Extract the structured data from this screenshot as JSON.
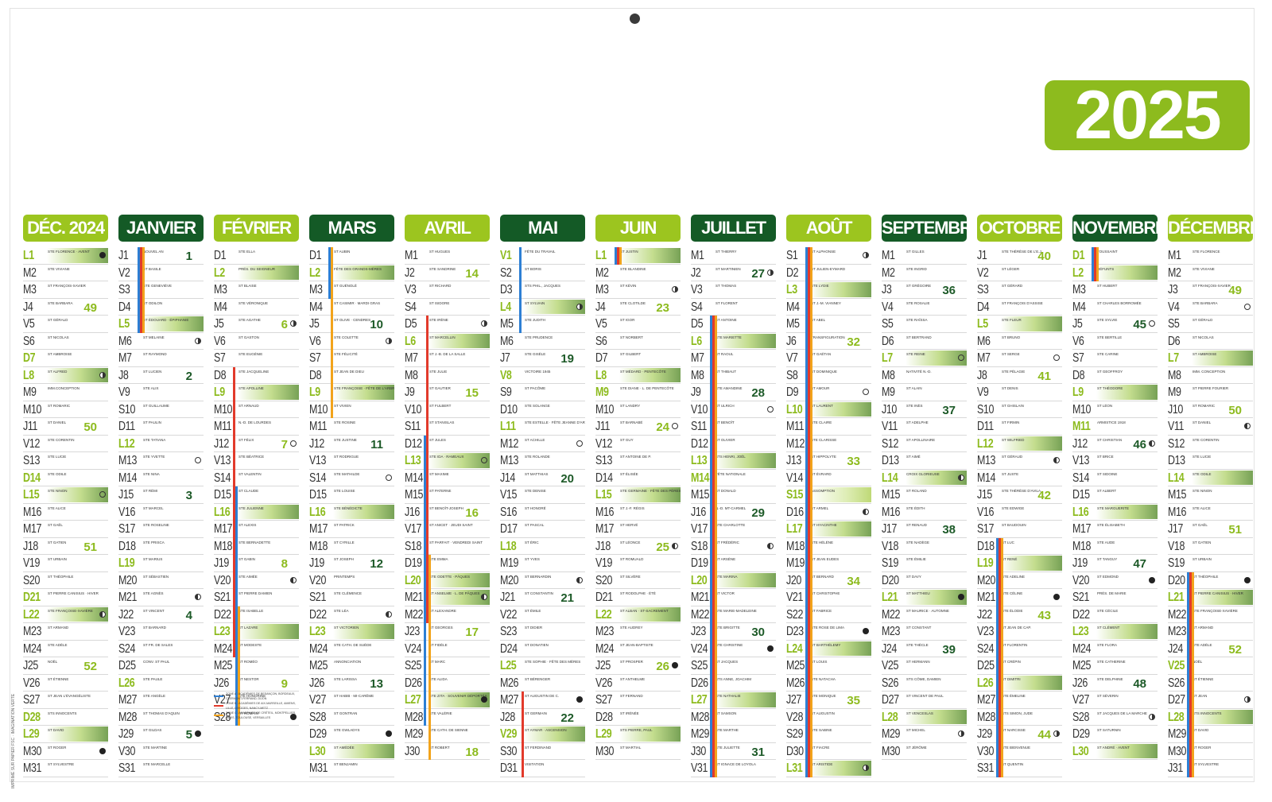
{
  "calendar": {
    "year": "2025",
    "side_text": "IMPRIMÉ SUR PAPIER FSC · IMAGINATION VERTE",
    "legend": [
      "ZONE A : ACADÉMIES DE BESANÇON, BORDEAUX, CLERMONT-FERRAND, DIJON",
      "ZONE B : ACADÉMIES DE AIX-MARSEILLE, AMIENS, LILLE, LIMOGES, NANCY-METZ",
      "ZONE C : ACADÉMIES DE CRÉTEIL, MONTPELLIER, PARIS, TOULOUSE, VERSAILLES"
    ],
    "legend_colors": [
      "#2d7fd4",
      "#e23a2b",
      "#f2a31b"
    ],
    "months": [
      {
        "name": "DÉC. 2024",
        "style": "light",
        "start": 0,
        "days": 31,
        "weekends": [
          1,
          7,
          8,
          14,
          15,
          21,
          22,
          28,
          29
        ],
        "weeks": {
          "4": "49",
          "11": "50",
          "18": "51",
          "25": "52"
        },
        "grad": [
          1,
          8,
          15,
          22,
          29
        ],
        "moons": {
          "1": "new",
          "8": "q1",
          "15": "full",
          "22": "q3",
          "30": "new"
        }
      },
      {
        "name": "JANVIER",
        "style": "dark",
        "start": 3,
        "days": 31,
        "weekends": [
          5,
          12,
          19,
          26
        ],
        "weeks": {
          "1": "1",
          "8": "2",
          "15": "3",
          "22": "4",
          "29": "5"
        },
        "grad": [
          5
        ],
        "moons": {
          "6": "q1",
          "13": "full",
          "21": "q3",
          "29": "new"
        },
        "vac": [
          [
            1,
            5,
            "#2d7fd4"
          ],
          [
            1,
            5,
            "#e23a2b"
          ],
          [
            1,
            5,
            "#f2a31b"
          ]
        ]
      },
      {
        "name": "FÉVRIER",
        "style": "light",
        "start": 6,
        "days": 28,
        "weekends": [
          2,
          9,
          16,
          23
        ],
        "weeks": {
          "5": "6",
          "12": "7",
          "19": "8",
          "26": "9"
        },
        "grad": [
          2,
          9,
          16,
          23
        ],
        "moons": {
          "5": "q1",
          "12": "full",
          "20": "q3",
          "28": "new"
        },
        "vac": [
          [
            8,
            24,
            "#e23a2b"
          ],
          [
            15,
            28,
            "#2d7fd4"
          ],
          [
            22,
            28,
            "#f2a31b"
          ]
        ]
      },
      {
        "name": "MARS",
        "style": "dark",
        "start": 6,
        "days": 31,
        "weekends": [
          2,
          9,
          16,
          23,
          30
        ],
        "weeks": {
          "5": "10",
          "12": "11",
          "19": "12",
          "26": "13"
        },
        "grad": [
          2,
          9,
          16,
          23,
          30
        ],
        "moons": {
          "6": "q1",
          "14": "full",
          "22": "q3",
          "29": "new"
        },
        "vac": [
          [
            1,
            3,
            "#2d7fd4"
          ],
          [
            1,
            10,
            "#f2a31b"
          ]
        ]
      },
      {
        "name": "AVRIL",
        "style": "light",
        "start": 2,
        "days": 30,
        "weekends": [
          6,
          13,
          20,
          27
        ],
        "weeks": {
          "2": "14",
          "9": "15",
          "16": "16",
          "23": "17",
          "30": "18"
        },
        "grad": [
          6,
          13,
          20,
          21,
          27
        ],
        "moons": {
          "5": "q1",
          "13": "full",
          "21": "q3",
          "27": "new"
        },
        "vac": [
          [
            12,
            28,
            "#2d7fd4"
          ],
          [
            5,
            22,
            "#e23a2b"
          ],
          [
            19,
            30,
            "#f2a31b"
          ]
        ]
      },
      {
        "name": "MAI",
        "style": "dark",
        "start": 4,
        "days": 31,
        "weekends": [
          1,
          4,
          8,
          11,
          18,
          25,
          29
        ],
        "weeks": {
          "7": "19",
          "14": "20",
          "21": "21",
          "28": "22"
        },
        "grad": [
          4,
          29
        ],
        "moons": {
          "4": "q1",
          "12": "full",
          "20": "q3",
          "27": "new"
        },
        "vac": [
          [
            1,
            5,
            "#2d7fd4"
          ],
          [
            27,
            31,
            "#e23a2b"
          ]
        ]
      },
      {
        "name": "JUIN",
        "style": "light",
        "start": 0,
        "days": 30,
        "weekends": [
          1,
          8,
          9,
          15,
          22,
          29
        ],
        "weeks": {
          "4": "23",
          "11": "24",
          "18": "25",
          "25": "26"
        },
        "grad": [
          1,
          8,
          15,
          22,
          29
        ],
        "moons": {
          "3": "q1",
          "11": "full",
          "18": "q3",
          "25": "new"
        },
        "vac": [
          [
            1,
            1,
            "#2d7fd4"
          ],
          [
            1,
            1,
            "#e23a2b"
          ],
          [
            1,
            1,
            "#f2a31b"
          ]
        ]
      },
      {
        "name": "JUILLET",
        "style": "dark",
        "start": 2,
        "days": 31,
        "weekends": [
          6,
          13,
          14,
          20,
          27
        ],
        "weeks": {
          "2": "27",
          "9": "28",
          "16": "29",
          "23": "30",
          "30": "31"
        },
        "grad": [
          6,
          13,
          20,
          27
        ],
        "moons": {
          "2": "q1",
          "10": "full",
          "18": "q3",
          "24": "new"
        },
        "vac": [
          [
            5,
            31,
            "#2d7fd4"
          ],
          [
            5,
            31,
            "#e23a2b"
          ],
          [
            5,
            31,
            "#f2a31b"
          ]
        ]
      },
      {
        "name": "AOÛT",
        "style": "light",
        "start": 5,
        "days": 31,
        "weekends": [
          3,
          10,
          15,
          17,
          24,
          31
        ],
        "weeks": {
          "6": "32",
          "13": "33",
          "20": "34",
          "27": "35"
        },
        "grad": [
          3,
          10,
          15,
          17,
          24,
          31
        ],
        "moons": {
          "1": "q1",
          "9": "full",
          "16": "q3",
          "23": "new",
          "31": "q1"
        },
        "vac": [
          [
            1,
            31,
            "#2d7fd4"
          ],
          [
            1,
            31,
            "#e23a2b"
          ],
          [
            1,
            31,
            "#f2a31b"
          ]
        ]
      },
      {
        "name": "SEPTEMBRE",
        "style": "dark",
        "start": 1,
        "days": 30,
        "weekends": [
          7,
          14,
          21,
          28
        ],
        "weeks": {
          "3": "36",
          "10": "37",
          "17": "38",
          "24": "39"
        },
        "grad": [
          7,
          14,
          21,
          28
        ],
        "moons": {
          "7": "full",
          "14": "q3",
          "21": "new",
          "29": "q1"
        }
      },
      {
        "name": "OCTOBRE",
        "style": "light",
        "start": 3,
        "days": 31,
        "weekends": [
          5,
          12,
          19,
          26
        ],
        "weeks": {
          "1": "40",
          "8": "41",
          "15": "42",
          "22": "43",
          "29": "44"
        },
        "grad": [
          5,
          12,
          19,
          26
        ],
        "moons": {
          "7": "full",
          "13": "q3",
          "21": "new",
          "29": "q1"
        },
        "vac": [
          [
            18,
            31,
            "#2d7fd4"
          ],
          [
            18,
            31,
            "#e23a2b"
          ],
          [
            18,
            31,
            "#f2a31b"
          ]
        ]
      },
      {
        "name": "NOVEMBRE",
        "style": "dark",
        "start": 6,
        "days": 30,
        "weekends": [
          1,
          2,
          9,
          11,
          16,
          23,
          30
        ],
        "weeks": {
          "5": "45",
          "12": "46",
          "19": "47",
          "26": "48"
        },
        "grad": [
          2,
          9,
          16,
          23,
          30
        ],
        "moons": {
          "5": "full",
          "12": "q3",
          "20": "new",
          "28": "q1"
        },
        "vac": [
          [
            1,
            2,
            "#2d7fd4"
          ],
          [
            1,
            2,
            "#e23a2b"
          ],
          [
            1,
            2,
            "#f2a31b"
          ]
        ]
      },
      {
        "name": "DÉCEMBRE",
        "style": "light",
        "start": 1,
        "days": 31,
        "weekends": [
          7,
          14,
          21,
          25,
          28
        ],
        "weeks": {
          "3": "49",
          "10": "50",
          "17": "51",
          "24": "52"
        },
        "grad": [
          7,
          14,
          21,
          28
        ],
        "moons": {
          "4": "full",
          "11": "q3",
          "20": "new",
          "27": "q1"
        },
        "vac": [
          [
            20,
            31,
            "#2d7fd4"
          ],
          [
            20,
            31,
            "#e23a2b"
          ],
          [
            20,
            31,
            "#f2a31b"
          ]
        ]
      }
    ],
    "letters": [
      "L",
      "M",
      "M",
      "J",
      "V",
      "S",
      "D"
    ],
    "saints": {
      "0": [
        "STE FLORENCE · AVENT",
        "STE VIVIANE",
        "ST FRANÇOIS-XAVIER",
        "STE BARBARA",
        "ST GÉRALD",
        "ST NICOLAS",
        "ST AMBROISE",
        "ST ALFRED",
        "IMM.CONCEPTION",
        "ST ROMARIC",
        "ST DANIEL",
        "STE CORENTIN",
        "STE LUCIE",
        "STE ODILE",
        "STE NINON",
        "STE ALICE",
        "ST GAËL",
        "ST GATIEN",
        "ST URBAIN",
        "ST THÉOPHILE",
        "ST PIERRE CANISIUS · HIVER",
        "STE FRANÇOISE-XAVIÈRE",
        "ST ARMAND",
        "STE ADÈLE",
        "NOËL",
        "ST ÉTIENNE",
        "ST JEAN L'ÉVANGÉLISTE",
        "STS INNOCENTS",
        "ST DAVID",
        "ST ROGER",
        "ST SYLVESTRE"
      ],
      "1": [
        "NOUVEL AN",
        "ST BASILE",
        "STE GENEVIÈVE",
        "ST ODILON",
        "ST ÉDOUARD · ÉPIPHANIE",
        "ST MELAINE",
        "ST RAYMOND",
        "ST LUCIEN",
        "STE ALIX",
        "ST GUILLAUME",
        "ST PAULIN",
        "STE TATIANA",
        "STE YVETTE",
        "STE NINA",
        "ST RÉMI",
        "ST MARCEL",
        "STE ROSELINE",
        "STE PRISCA",
        "ST MARIUS",
        "ST SÉBASTIEN",
        "STE AGNÈS",
        "ST VINCENT",
        "ST BARNARD",
        "ST FR. DE SALES",
        "CONV. ST PAUL",
        "STE PAULE",
        "STE ANGÈLE",
        "ST THOMAS D'AQUIN",
        "ST GILDAS",
        "STE MARTINE",
        "STE MARCELLE"
      ],
      "2": [
        "STE ELLA",
        "PRÉS. DU SEIGNEUR",
        "ST BLAISE",
        "STE VÉRONIQUE",
        "STE AGATHE",
        "ST GASTON",
        "STE EUGÉNIE",
        "STE JACQUELINE",
        "STE APOLLINE",
        "ST ARNAUD",
        "N.-D. DE LOURDES",
        "ST FÉLIX",
        "STE BÉATRICE",
        "ST VALENTIN",
        "ST CLAUDE",
        "STE JULIENNE",
        "ST ALEXIS",
        "STE BERNADETTE",
        "ST GABIN",
        "STE AIMÉE",
        "ST PIERRE DAMIEN",
        "STE ISABELLE",
        "ST LAZARE",
        "ST MODESTE",
        "ST ROMÉO",
        "ST NESTOR",
        "STE HONORINE",
        "ST ROMAIN"
      ],
      "3": [
        "ST AUBIN",
        "FÊTE DES GRANDS-MÈRES",
        "ST GUÉNOLÉ",
        "ST CASIMIR · MARDI GRAS",
        "ST OLIVE · CENDRES",
        "STE COLETTE",
        "STE FÉLICITÉ",
        "ST JEAN DE DIEU",
        "STE FRANÇOISE · FÊTE DE L'ARBRE",
        "ST VIVIEN",
        "STE ROSINE",
        "STE JUSTINE",
        "ST RODRIGUE",
        "STE MATHILDE",
        "STE LOUISE",
        "STE BÉNÉDICTE",
        "ST PATRICK",
        "ST CYRILLE",
        "ST JOSEPH",
        "PRINTEMPS",
        "STE CLÉMENCE",
        "STE LÉA",
        "ST VICTORIEN",
        "STE CATH. DE SUÈDE",
        "ANNONCIATION",
        "STE LARISSA",
        "ST HABIB · MI-CARÊME",
        "ST GONTRAN",
        "STE GWLADYS",
        "ST AMÉDÉE",
        "ST BENJAMIN"
      ],
      "4": [
        "ST HUGUES",
        "STE SANDRINE",
        "ST RICHARD",
        "ST ISIDORE",
        "STE IRÈNE",
        "ST MARCELLIN",
        "ST J.-B. DE LA SALLE",
        "STE JULIE",
        "ST GAUTIER",
        "ST FULBERT",
        "ST STANISLAS",
        "ST JULES",
        "STE IDA · RAMEAUX",
        "ST MAXIME",
        "ST PATERNE",
        "ST BENOÎT-JOSEPH",
        "ST ANICET · JEUDI SAINT",
        "ST PARFAIT · VENDREDI SAINT",
        "STE EMMA",
        "STE ODETTE · PÂQUES",
        "ST ANSELME · L. DE PÂQUES",
        "ST ALEXANDRE",
        "ST GEORGES",
        "ST FIDÈLE",
        "ST MARC",
        "STE ALIDA",
        "STE ZITA · SOUVENIR DÉPORTÉS",
        "STE VALÉRIE",
        "STE CATH. DE SIENNE",
        "ST ROBERT"
      ],
      "5": [
        "FÊTE DU TRAVAIL",
        "ST BORIS",
        "STS PHIL., JACQUES",
        "ST SYLVAIN",
        "STE JUDITH",
        "STE PRUDENCE",
        "STE GISÈLE",
        "VICTOIRE 1945",
        "ST PACÔME",
        "STE SOLANGE",
        "STE ESTELLE · FÊTE JEANNE D'ARC",
        "ST ACHILLE",
        "STE ROLANDE",
        "ST MATTHIAS",
        "STE DENISE",
        "ST HONORÉ",
        "ST PASCAL",
        "ST ÉRIC",
        "ST YVES",
        "ST BERNARDIN",
        "ST CONSTANTIN",
        "ST ÉMILE",
        "ST DIDIER",
        "ST DONATIEN",
        "STE SOPHIE · FÊTE DES MÈRES",
        "ST BÉRENGER",
        "ST AUGUSTIN DE C.",
        "ST GERMAIN",
        "ST AYMAR · ASCENSION",
        "ST FERDINAND",
        "VISITATION"
      ],
      "6": [
        "ST JUSTIN",
        "STE BLANDINE",
        "ST KÉVIN",
        "STE CLOTILDE",
        "ST IGOR",
        "ST NORBERT",
        "ST GILBERT",
        "ST MÉDARD · PENTECÔTE",
        "STE DIANE · L. DE PENTECÔTE",
        "ST LANDRY",
        "ST BARNABÉ",
        "ST GUY",
        "ST ANTOINE DE P.",
        "ST ÉLISÉE",
        "STE GERMAINE · FÊTE DES PÈRES",
        "ST J.-F. RÉGIS",
        "ST HERVÉ",
        "ST LÉONCE",
        "ST ROMUALD",
        "ST SILVÈRE",
        "ST RODOLPHE · ÉTÉ",
        "ST ALBAN · ST-SACREMENT",
        "STE AUDREY",
        "ST JEAN-BAPTISTE",
        "ST PROSPER",
        "ST ANTHELME",
        "ST FERNAND",
        "ST IRÉNÉE",
        "STS PIERRE, PAUL",
        "ST MARTIAL"
      ],
      "7": [
        "ST THIERRY",
        "ST MARTINIEN",
        "ST THOMAS",
        "ST FLORENT",
        "ST ANTOINE",
        "STE MARIETTE",
        "ST RAOUL",
        "ST THIBAUT",
        "STE AMANDINE",
        "ST ULRICH",
        "ST BENOÎT",
        "ST OLIVIER",
        "STS HENRI, JOËL",
        "FÊTE NATIONALE",
        "ST DONALD",
        "N.-D. MT-CARMEL",
        "STE CHARLOTTE",
        "ST FRÉDÉRIC",
        "ST ARSÈNE",
        "STE MARINA",
        "ST VICTOR",
        "STE MARIE-MADELEINE",
        "STE BRIGITTE",
        "STE CHRISTINE",
        "ST JACQUES",
        "STS ANNE, JOACHIM",
        "STE NATHALIE",
        "ST SAMSON",
        "STE MARTHE",
        "STE JULIETTE",
        "ST IGNACE DE LOYOLA"
      ],
      "8": [
        "ST ALPHONSE",
        "ST JULIEN-EYMARD",
        "STE LYDIE",
        "ST J.-M. VIANNEY",
        "ST ABEL",
        "TRANSFIGURATION",
        "ST GAÉTAN",
        "ST DOMINIQUE",
        "ST AMOUR",
        "ST LAURENT",
        "STE CLAIRE",
        "STE CLARISSE",
        "ST HIPPOLYTE",
        "ST ÉVRARD",
        "ASSOMPTION",
        "ST ARMEL",
        "ST HYACINTHE",
        "STE HÉLÈNE",
        "ST JEAN EUDES",
        "ST BERNARD",
        "ST CHRISTOPHE",
        "ST FABRICE",
        "STE ROSE DE LIMA",
        "ST BARTHÉLEMY",
        "ST LOUIS",
        "STE NATACHA",
        "STE MONIQUE",
        "ST AUGUSTIN",
        "STE SABINE",
        "ST FIACRE",
        "ST ARISTIDE"
      ],
      "9": [
        "ST GILLES",
        "STE INGRID",
        "ST GRÉGOIRE",
        "STE ROSALIE",
        "STE RAÏSSA",
        "ST BERTRAND",
        "STE REINE",
        "NATIVITÉ N.-D.",
        "ST ALAIN",
        "STE INÈS",
        "ST ADELPHE",
        "ST APOLLINAIRE",
        "ST AIMÉ",
        "CROIX GLORIEUSE",
        "ST ROLAND",
        "STE ÉDITH",
        "ST RENAUD",
        "STE NADÈGE",
        "STE ÉMILIE",
        "ST DAVY",
        "ST MATTHIEU",
        "ST MAURICE · AUTOMNE",
        "ST CONSTANT",
        "STE THÈCLE",
        "ST HERMANN",
        "STS CÔME, DAMIEN",
        "ST VINCENT DE PAUL",
        "ST VENCESLAS",
        "ST MICHEL",
        "ST JÉRÔME"
      ],
      "10": [
        "STE THÉRÈSE DE L'E.J.",
        "ST LÉGER",
        "ST GÉRARD",
        "ST FRANÇOIS D'ASSISE",
        "STE FLEUR",
        "ST BRUNO",
        "ST SERGE",
        "STE PÉLAGIE",
        "ST DENIS",
        "ST GHISLAIN",
        "ST FIRMIN",
        "ST WILFRIED",
        "ST GÉRAUD",
        "ST JUSTE",
        "STE THÉRÈSE D'AVILA",
        "STE EDWIGE",
        "ST BAUDOUIN",
        "ST LUC",
        "ST RENÉ",
        "STE ADELINE",
        "STE CÉLINE",
        "STE ÉLODIE",
        "ST JEAN DE CAP.",
        "ST FLORENTIN",
        "ST CRÉPIN",
        "ST DIMITRI",
        "STE ÉMELINE",
        "STS SIMON, JUDE",
        "ST NARCISSE",
        "STE BIENVENUE",
        "ST QUENTIN"
      ],
      "11": [
        "TOUSSAINT",
        "DÉFUNTS",
        "ST HUBERT",
        "ST CHARLES BORROMÉE",
        "STE SYLVIE",
        "STE BERTILLE",
        "STE CARINE",
        "ST GEOFFROY",
        "ST THÉODORE",
        "ST LÉON",
        "ARMISTICE 1918",
        "ST CHRISTIAN",
        "ST BRICE",
        "ST SIDOINE",
        "ST ALBERT",
        "STE MARGUERITE",
        "STE ÉLISABETH",
        "STE AUDE",
        "ST TANGUY",
        "ST EDMOND",
        "PRÉS. DE MARIE",
        "STE CÉCILE",
        "ST CLÉMENT",
        "STE FLORA",
        "STE CATHERINE",
        "STE DELPHINE",
        "ST SÉVERIN",
        "ST JACQUES DE LA MARCHE",
        "ST SATURNIN",
        "ST ANDRÉ · AVENT"
      ],
      "12": [
        "STE FLORENCE",
        "STE VIVIANE",
        "ST FRANÇOIS-XAVIER",
        "STE BARBARA",
        "ST GÉRALD",
        "ST NICOLAS",
        "ST AMBROISE",
        "IMM. CONCEPTION",
        "ST PIERRE FOURIER",
        "ST ROMARIC",
        "ST DANIEL",
        "STE CORENTIN",
        "STE LUCIE",
        "STE ODILE",
        "STE NINON",
        "STE ALICE",
        "ST GAËL",
        "ST GATIEN",
        "ST URBAIN",
        "ST THÉOPHILE",
        "ST PIERRE CANISIUS · HIVER",
        "STE FRANÇOISE-XAVIÈRE",
        "ST ARMAND",
        "STE ADÈLE",
        "NOËL",
        "ST ÉTIENNE",
        "ST JEAN",
        "STS INNOCENTS",
        "ST DAVID",
        "ST ROGER",
        "ST SYLVESTRE"
      ]
    }
  }
}
